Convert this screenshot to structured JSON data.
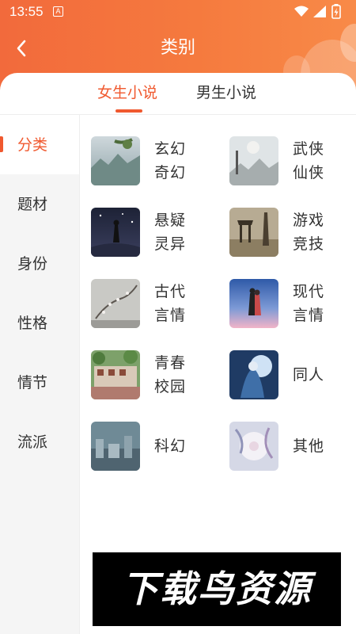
{
  "status_bar": {
    "time": "13:55",
    "notification_badge": "A"
  },
  "header": {
    "title": "类别",
    "back_icon": "chevron-left-icon"
  },
  "tabs": [
    {
      "label": "女生小说",
      "active": true
    },
    {
      "label": "男生小说",
      "active": false
    }
  ],
  "sidebar": {
    "items": [
      {
        "label": "分类",
        "active": true
      },
      {
        "label": "题材",
        "active": false
      },
      {
        "label": "身份",
        "active": false
      },
      {
        "label": "性格",
        "active": false
      },
      {
        "label": "情节",
        "active": false
      },
      {
        "label": "流派",
        "active": false
      }
    ]
  },
  "categories": [
    {
      "line1": "玄幻",
      "line2": "奇幻"
    },
    {
      "line1": "武侠",
      "line2": "仙侠"
    },
    {
      "line1": "悬疑",
      "line2": "灵异"
    },
    {
      "line1": "游戏",
      "line2": "竞技"
    },
    {
      "line1": "古代",
      "line2": "言情"
    },
    {
      "line1": "现代",
      "line2": "言情"
    },
    {
      "line1": "青春",
      "line2": "校园"
    },
    {
      "line1": "同人",
      "line2": ""
    },
    {
      "line1": "科幻",
      "line2": ""
    },
    {
      "line1": "其他",
      "line2": ""
    }
  ],
  "watermark": {
    "text": "下载鸟资源"
  },
  "colors": {
    "accent": "#f0592f",
    "header_gradient_start": "#f26a3c",
    "header_gradient_end": "#f88a48",
    "sidebar_bg": "#f5f5f5"
  }
}
